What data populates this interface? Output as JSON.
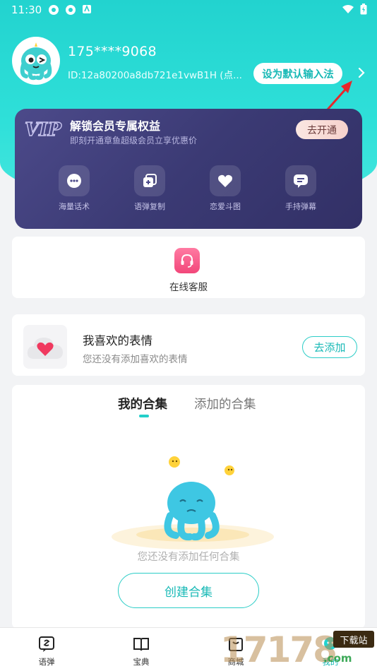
{
  "status_bar": {
    "time": "11:30"
  },
  "profile": {
    "phone": "175****9068",
    "id_text": "ID:12a80200a8db721e1vwB1H (点...",
    "default_ime_button": "设为默认输入法"
  },
  "vip": {
    "logo_text": "VIP",
    "title": "解锁会员专属权益",
    "subtitle": "即刻开通章鱼超级会员立享优惠价",
    "open_button": "去开通",
    "perks": [
      {
        "label": "海量话术",
        "icon": "chat-bubble-icon"
      },
      {
        "label": "语弹复制",
        "icon": "copy-icon"
      },
      {
        "label": "恋爱斗图",
        "icon": "heart-icon"
      },
      {
        "label": "手持弹幕",
        "icon": "message-icon"
      }
    ]
  },
  "customer_service": {
    "label": "在线客服",
    "icon": "headset-icon"
  },
  "favorites": {
    "title": "我喜欢的表情",
    "subtitle": "您还没有添加喜欢的表情",
    "add_button": "去添加"
  },
  "collections": {
    "tabs": [
      {
        "label": "我的合集"
      },
      {
        "label": "添加的合集"
      }
    ],
    "active_tab": 0,
    "empty_text": "您还没有添加任何合集",
    "create_button": "创建合集"
  },
  "bottom_nav": [
    {
      "label": "语弹",
      "icon": "speech-icon"
    },
    {
      "label": "宝典",
      "icon": "book-icon"
    },
    {
      "label": "商城",
      "icon": "shop-icon"
    },
    {
      "label": "我的",
      "icon": "profile-icon"
    }
  ],
  "watermark": {
    "number": "17178",
    "badge": "下载站",
    "domain": ".com"
  },
  "colors": {
    "accent": "#22d3cf",
    "vip_bg": "#3b3a74",
    "pink": "#f2477a"
  }
}
